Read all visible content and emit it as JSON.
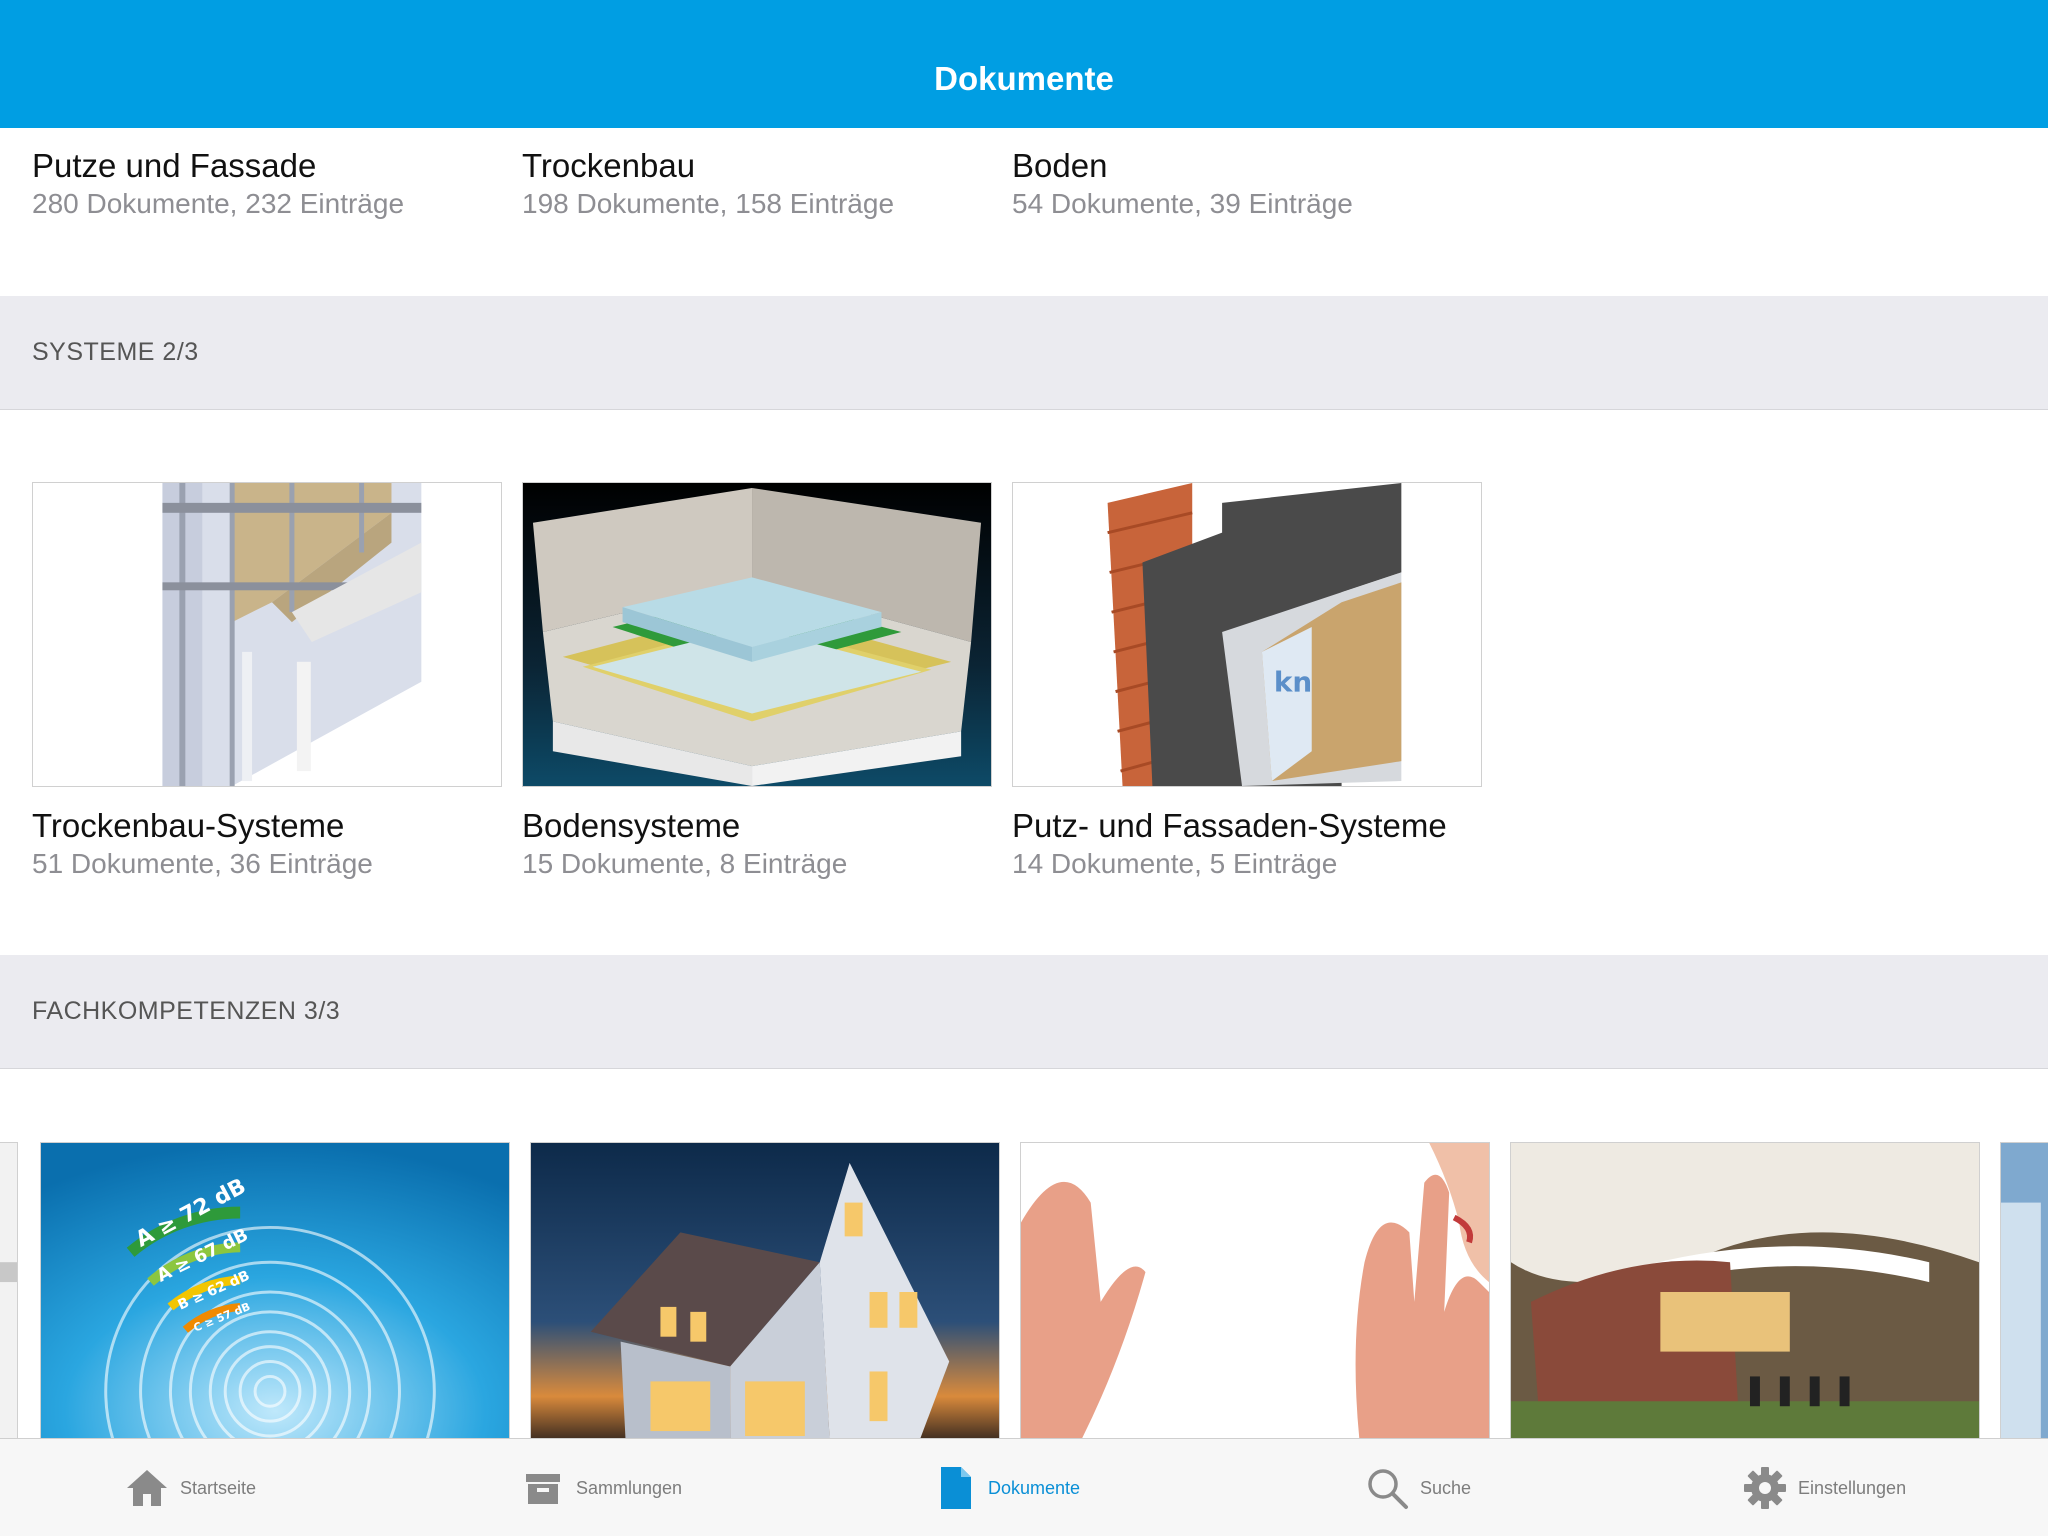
{
  "navbar": {
    "title": "Dokumente"
  },
  "top_categories": [
    {
      "title": "Putze und Fassade",
      "subtitle": "280 Dokumente, 232 Einträge"
    },
    {
      "title": "Trockenbau",
      "subtitle": "198 Dokumente, 158 Einträge"
    },
    {
      "title": "Boden",
      "subtitle": "54 Dokumente, 39 Einträge"
    }
  ],
  "sections": {
    "systeme": {
      "header": "SYSTEME 2/3",
      "items": [
        {
          "title": "Trockenbau-Systeme",
          "subtitle": "51 Dokumente, 36 Einträge"
        },
        {
          "title": "Bodensysteme",
          "subtitle": "15 Dokumente, 8 Einträge"
        },
        {
          "title": "Putz- und Fassaden-Systeme",
          "subtitle": "14 Dokumente, 5 Einträge"
        }
      ]
    },
    "fachkompetenzen": {
      "header": "FACHKOMPETENZEN 3/3",
      "badge": {
        "a": "A ≥ 72 dB",
        "b": "A ≥ 67 dB",
        "c": "B ≥ 62 dB",
        "d": "C ≥ 57 dB"
      }
    }
  },
  "tabbar": {
    "tabs": [
      {
        "label": "Startseite",
        "icon": "house-icon"
      },
      {
        "label": "Sammlungen",
        "icon": "archive-box-icon"
      },
      {
        "label": "Dokumente",
        "icon": "document-icon",
        "active": true
      },
      {
        "label": "Suche",
        "icon": "magnifier-icon"
      },
      {
        "label": "Einstellungen",
        "icon": "gear-icon"
      }
    ]
  },
  "colors": {
    "accent": "#009ee3",
    "active_tab": "#0a8fd6",
    "section_bg": "#ebebf0"
  }
}
